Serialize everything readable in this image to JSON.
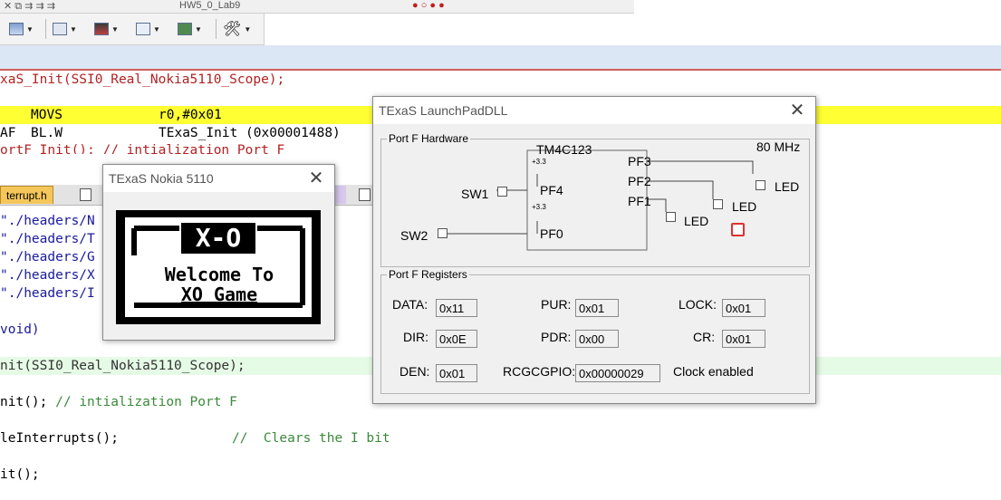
{
  "toolbar1": {
    "target": "HW5_0_Lab9"
  },
  "editor": {
    "line1": "xaS_Init(SSI0_Real_Nokia5110_Scope);",
    "asm_instr": "MOVS",
    "asm_operands": "r0,#0x01",
    "asm2_prefix": "AF",
    "asm2_instr": "BL.W",
    "asm2_operands": "TExaS_Init (0x00001488)",
    "line4": "ortF_Init(); // intialization Port F",
    "inc1": "\"./headers/N",
    "inc2": "\"./headers/T",
    "inc3": "\"./headers/G",
    "inc4": "\"./headers/X",
    "inc5": "\"./headers/I",
    "void": "void)",
    "init_call": "nit(SSI0_Real_Nokia5110_Scope);",
    "portf_code": "nit();",
    "portf_comment": "// intialization Port F",
    "enable_code": "leInterrupts();",
    "enable_comment": "//  Clears the I bit",
    "last": "it();"
  },
  "tabs": {
    "active": "terrupt.h"
  },
  "nokia": {
    "title": "TExaS Nokia 5110",
    "row1": "X-O",
    "row2": "Welcome To",
    "row3": "XO Game"
  },
  "launchpad": {
    "title": "TExaS LaunchPadDLL",
    "hw_group": "Port F Hardware",
    "chip": "TM4C123",
    "freq": "80 MHz",
    "pf3": "PF3",
    "pf2": "PF2",
    "pf1": "PF1",
    "pf4": "PF4",
    "pf0": "PF0",
    "sw1": "SW1",
    "sw2": "SW2",
    "led": "LED",
    "v33": "+3.3",
    "reg_group": "Port F Registers",
    "data_lbl": "DATA:",
    "data_val": "0x11",
    "pur_lbl": "PUR:",
    "pur_val": "0x01",
    "lock_lbl": "LOCK:",
    "lock_val": "0x01",
    "dir_lbl": "DIR:",
    "dir_val": "0x0E",
    "pdr_lbl": "PDR:",
    "pdr_val": "0x00",
    "cr_lbl": "CR:",
    "cr_val": "0x01",
    "den_lbl": "DEN:",
    "den_val": "0x01",
    "rcgc_lbl": "RCGCGPIO:",
    "rcgc_val": "0x00000029",
    "clock": "Clock enabled"
  },
  "colors": {
    "exec_highlight": "#ffff33",
    "tab_active": "#f5c659",
    "led_on": "#e03030"
  }
}
